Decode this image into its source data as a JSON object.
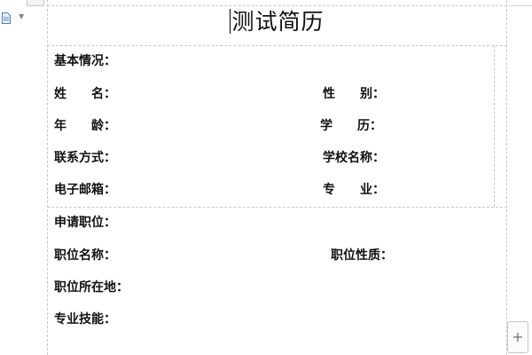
{
  "document": {
    "title": "测试简历",
    "sections": {
      "basic": {
        "heading": "基本情况：",
        "name": "姓　　名：",
        "gender": "性　　别：",
        "age": "年　　龄：",
        "education": "学　　历：",
        "contact": "联系方式：",
        "school": "学校名称：",
        "email": "电子邮箱：",
        "major": "专　　业："
      },
      "application": {
        "heading": "申请职位：",
        "position_name": "职位名称：",
        "position_type": "职位性质：",
        "location": "职位所在地：",
        "skills": "专业技能："
      }
    }
  },
  "controls": {
    "add_button": "+"
  },
  "icons": {
    "doc_icon": "document-icon",
    "dropdown": "chevron-down-icon",
    "add": "plus-icon"
  },
  "colors": {
    "dashed_rule": "#c8c8c8",
    "icon_blue": "#4a7fc1"
  }
}
